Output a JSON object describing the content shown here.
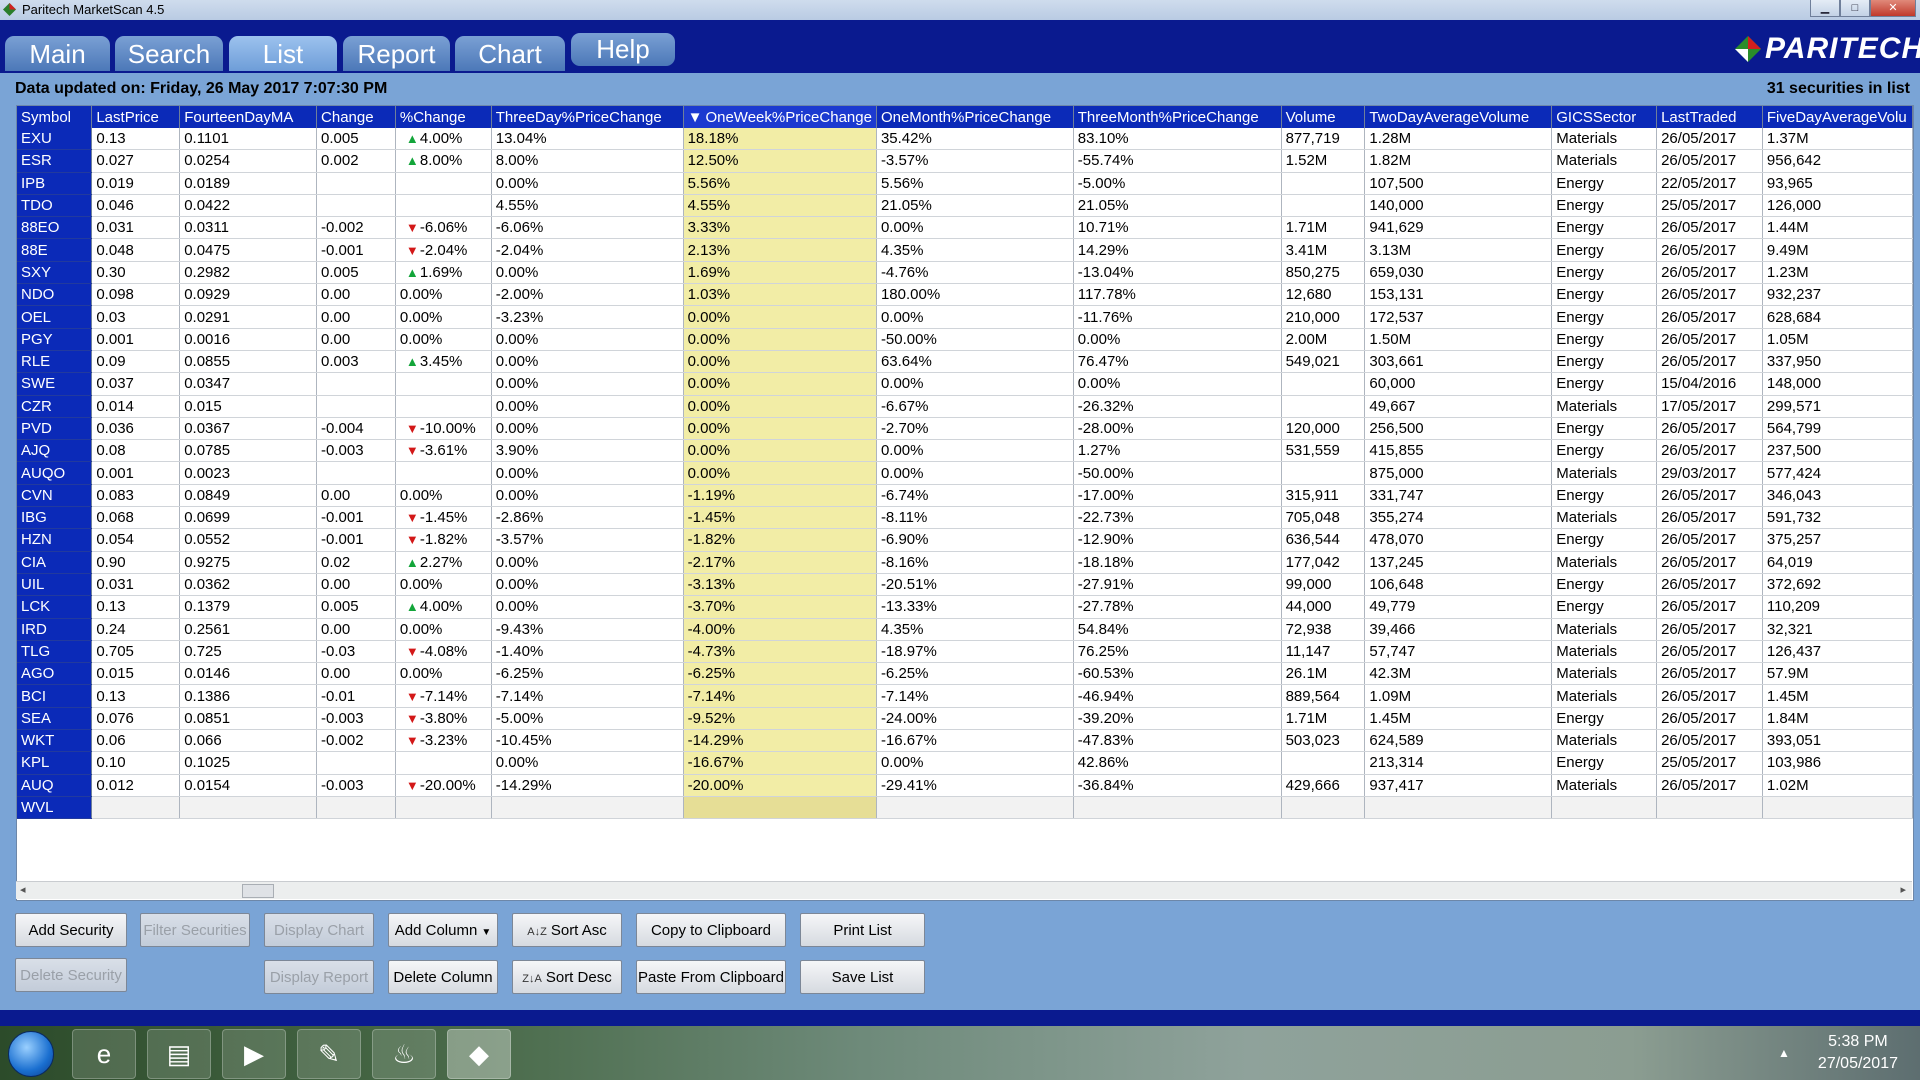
{
  "window": {
    "title": "Paritech MarketScan 4.5"
  },
  "tabs": [
    {
      "label": "Main"
    },
    {
      "label": "Search"
    },
    {
      "label": "List"
    },
    {
      "label": "Report"
    },
    {
      "label": "Chart"
    },
    {
      "label": "Help"
    }
  ],
  "active_tab": "List",
  "logo": {
    "text": "PARITECH"
  },
  "status": {
    "updated": "Data updated on: Friday, 26 May 2017 7:07:30 PM",
    "count": "31 securities in list"
  },
  "table": {
    "sorted_column": "OneWeek%PriceChange",
    "sort_indicator": "▼",
    "columns": [
      "Symbol",
      "LastPrice",
      "FourteenDayMA",
      "Change",
      "%Change",
      "ThreeDay%PriceChange",
      "OneWeek%PriceChange",
      "OneMonth%PriceChange",
      "ThreeMonth%PriceChange",
      "Volume",
      "TwoDayAverageVolume",
      "GICSSector",
      "LastTraded",
      "FiveDayAverageVolu"
    ],
    "rows": [
      [
        "EXU",
        "0.13",
        "0.1101",
        "0.005",
        "4.00%",
        "13.04%",
        "18.18%",
        "35.42%",
        "83.10%",
        "877,719",
        "1.28M",
        "Materials",
        "26/05/2017",
        "1.37M"
      ],
      [
        "ESR",
        "0.027",
        "0.0254",
        "0.002",
        "8.00%",
        "8.00%",
        "12.50%",
        "-3.57%",
        "-55.74%",
        "1.52M",
        "1.82M",
        "Materials",
        "26/05/2017",
        "956,642"
      ],
      [
        "IPB",
        "0.019",
        "0.0189",
        "",
        "",
        "0.00%",
        "5.56%",
        "5.56%",
        "-5.00%",
        "",
        "107,500",
        "Energy",
        "22/05/2017",
        "93,965"
      ],
      [
        "TDO",
        "0.046",
        "0.0422",
        "",
        "",
        "4.55%",
        "4.55%",
        "21.05%",
        "21.05%",
        "",
        "140,000",
        "Energy",
        "25/05/2017",
        "126,000"
      ],
      [
        "88EO",
        "0.031",
        "0.0311",
        "-0.002",
        "-6.06%",
        "-6.06%",
        "3.33%",
        "0.00%",
        "10.71%",
        "1.71M",
        "941,629",
        "Energy",
        "26/05/2017",
        "1.44M"
      ],
      [
        "88E",
        "0.048",
        "0.0475",
        "-0.001",
        "-2.04%",
        "-2.04%",
        "2.13%",
        "4.35%",
        "14.29%",
        "3.41M",
        "3.13M",
        "Energy",
        "26/05/2017",
        "9.49M"
      ],
      [
        "SXY",
        "0.30",
        "0.2982",
        "0.005",
        "1.69%",
        "0.00%",
        "1.69%",
        "-4.76%",
        "-13.04%",
        "850,275",
        "659,030",
        "Energy",
        "26/05/2017",
        "1.23M"
      ],
      [
        "NDO",
        "0.098",
        "0.0929",
        "0.00",
        "0.00%",
        "-2.00%",
        "1.03%",
        "180.00%",
        "117.78%",
        "12,680",
        "153,131",
        "Energy",
        "26/05/2017",
        "932,237"
      ],
      [
        "OEL",
        "0.03",
        "0.0291",
        "0.00",
        "0.00%",
        "-3.23%",
        "0.00%",
        "0.00%",
        "-11.76%",
        "210,000",
        "172,537",
        "Energy",
        "26/05/2017",
        "628,684"
      ],
      [
        "PGY",
        "0.001",
        "0.0016",
        "0.00",
        "0.00%",
        "0.00%",
        "0.00%",
        "-50.00%",
        "0.00%",
        "2.00M",
        "1.50M",
        "Energy",
        "26/05/2017",
        "1.05M"
      ],
      [
        "RLE",
        "0.09",
        "0.0855",
        "0.003",
        "3.45%",
        "0.00%",
        "0.00%",
        "63.64%",
        "76.47%",
        "549,021",
        "303,661",
        "Energy",
        "26/05/2017",
        "337,950"
      ],
      [
        "SWE",
        "0.037",
        "0.0347",
        "",
        "",
        "0.00%",
        "0.00%",
        "0.00%",
        "0.00%",
        "",
        "60,000",
        "Energy",
        "15/04/2016",
        "148,000"
      ],
      [
        "CZR",
        "0.014",
        "0.015",
        "",
        "",
        "0.00%",
        "0.00%",
        "-6.67%",
        "-26.32%",
        "",
        "49,667",
        "Materials",
        "17/05/2017",
        "299,571"
      ],
      [
        "PVD",
        "0.036",
        "0.0367",
        "-0.004",
        "-10.00%",
        "0.00%",
        "0.00%",
        "-2.70%",
        "-28.00%",
        "120,000",
        "256,500",
        "Energy",
        "26/05/2017",
        "564,799"
      ],
      [
        "AJQ",
        "0.08",
        "0.0785",
        "-0.003",
        "-3.61%",
        "3.90%",
        "0.00%",
        "0.00%",
        "1.27%",
        "531,559",
        "415,855",
        "Energy",
        "26/05/2017",
        "237,500"
      ],
      [
        "AUQO",
        "0.001",
        "0.0023",
        "",
        "",
        "0.00%",
        "0.00%",
        "0.00%",
        "-50.00%",
        "",
        "875,000",
        "Materials",
        "29/03/2017",
        "577,424"
      ],
      [
        "CVN",
        "0.083",
        "0.0849",
        "0.00",
        "0.00%",
        "0.00%",
        "-1.19%",
        "-6.74%",
        "-17.00%",
        "315,911",
        "331,747",
        "Energy",
        "26/05/2017",
        "346,043"
      ],
      [
        "IBG",
        "0.068",
        "0.0699",
        "-0.001",
        "-1.45%",
        "-2.86%",
        "-1.45%",
        "-8.11%",
        "-22.73%",
        "705,048",
        "355,274",
        "Materials",
        "26/05/2017",
        "591,732"
      ],
      [
        "HZN",
        "0.054",
        "0.0552",
        "-0.001",
        "-1.82%",
        "-3.57%",
        "-1.82%",
        "-6.90%",
        "-12.90%",
        "636,544",
        "478,070",
        "Energy",
        "26/05/2017",
        "375,257"
      ],
      [
        "CIA",
        "0.90",
        "0.9275",
        "0.02",
        "2.27%",
        "0.00%",
        "-2.17%",
        "-8.16%",
        "-18.18%",
        "177,042",
        "137,245",
        "Materials",
        "26/05/2017",
        "64,019"
      ],
      [
        "UIL",
        "0.031",
        "0.0362",
        "0.00",
        "0.00%",
        "0.00%",
        "-3.13%",
        "-20.51%",
        "-27.91%",
        "99,000",
        "106,648",
        "Energy",
        "26/05/2017",
        "372,692"
      ],
      [
        "LCK",
        "0.13",
        "0.1379",
        "0.005",
        "4.00%",
        "0.00%",
        "-3.70%",
        "-13.33%",
        "-27.78%",
        "44,000",
        "49,779",
        "Energy",
        "26/05/2017",
        "110,209"
      ],
      [
        "IRD",
        "0.24",
        "0.2561",
        "0.00",
        "0.00%",
        "-9.43%",
        "-4.00%",
        "4.35%",
        "54.84%",
        "72,938",
        "39,466",
        "Materials",
        "26/05/2017",
        "32,321"
      ],
      [
        "TLG",
        "0.705",
        "0.725",
        "-0.03",
        "-4.08%",
        "-1.40%",
        "-4.73%",
        "-18.97%",
        "76.25%",
        "11,147",
        "57,747",
        "Materials",
        "26/05/2017",
        "126,437"
      ],
      [
        "AGO",
        "0.015",
        "0.0146",
        "0.00",
        "0.00%",
        "-6.25%",
        "-6.25%",
        "-6.25%",
        "-60.53%",
        "26.1M",
        "42.3M",
        "Materials",
        "26/05/2017",
        "57.9M"
      ],
      [
        "BCI",
        "0.13",
        "0.1386",
        "-0.01",
        "-7.14%",
        "-7.14%",
        "-7.14%",
        "-7.14%",
        "-46.94%",
        "889,564",
        "1.09M",
        "Materials",
        "26/05/2017",
        "1.45M"
      ],
      [
        "SEA",
        "0.076",
        "0.0851",
        "-0.003",
        "-3.80%",
        "-5.00%",
        "-9.52%",
        "-24.00%",
        "-39.20%",
        "1.71M",
        "1.45M",
        "Energy",
        "26/05/2017",
        "1.84M"
      ],
      [
        "WKT",
        "0.06",
        "0.066",
        "-0.002",
        "-3.23%",
        "-10.45%",
        "-14.29%",
        "-16.67%",
        "-47.83%",
        "503,023",
        "624,589",
        "Materials",
        "26/05/2017",
        "393,051"
      ],
      [
        "KPL",
        "0.10",
        "0.1025",
        "",
        "",
        "0.00%",
        "-16.67%",
        "0.00%",
        "42.86%",
        "",
        "213,314",
        "Energy",
        "25/05/2017",
        "103,986"
      ],
      [
        "AUQ",
        "0.012",
        "0.0154",
        "-0.003",
        "-20.00%",
        "-14.29%",
        "-20.00%",
        "-29.41%",
        "-36.84%",
        "429,666",
        "937,417",
        "Materials",
        "26/05/2017",
        "1.02M"
      ],
      [
        "WVL",
        "",
        "",
        "",
        "",
        "",
        "",
        "",
        "",
        "",
        "",
        "",
        "",
        ""
      ]
    ]
  },
  "buttons": {
    "add_security": "Add Security",
    "filter_securities": "Filter Securities",
    "display_chart": "Display Chart",
    "add_column": "Add Column",
    "sort_asc": "Sort Asc",
    "copy_clipboard": "Copy to Clipboard",
    "print_list": "Print List",
    "delete_security": "Delete Security",
    "display_report": "Display Report",
    "delete_column": "Delete Column",
    "sort_desc": "Sort Desc",
    "paste_clipboard": "Paste From Clipboard",
    "save_list": "Save List"
  },
  "taskbar": {
    "time": "5:38 PM",
    "date": "27/05/2017",
    "apps": [
      "internet-explorer-icon",
      "folder-icon",
      "media-player-icon",
      "paint-icon",
      "java-icon",
      "marketscan-icon"
    ]
  },
  "colors": {
    "header_blue": "#0a1a8f",
    "panel_blue": "#7aa4d6",
    "sorted_column": "#f2eda6",
    "up": "#13a53a",
    "down": "#d31818"
  }
}
